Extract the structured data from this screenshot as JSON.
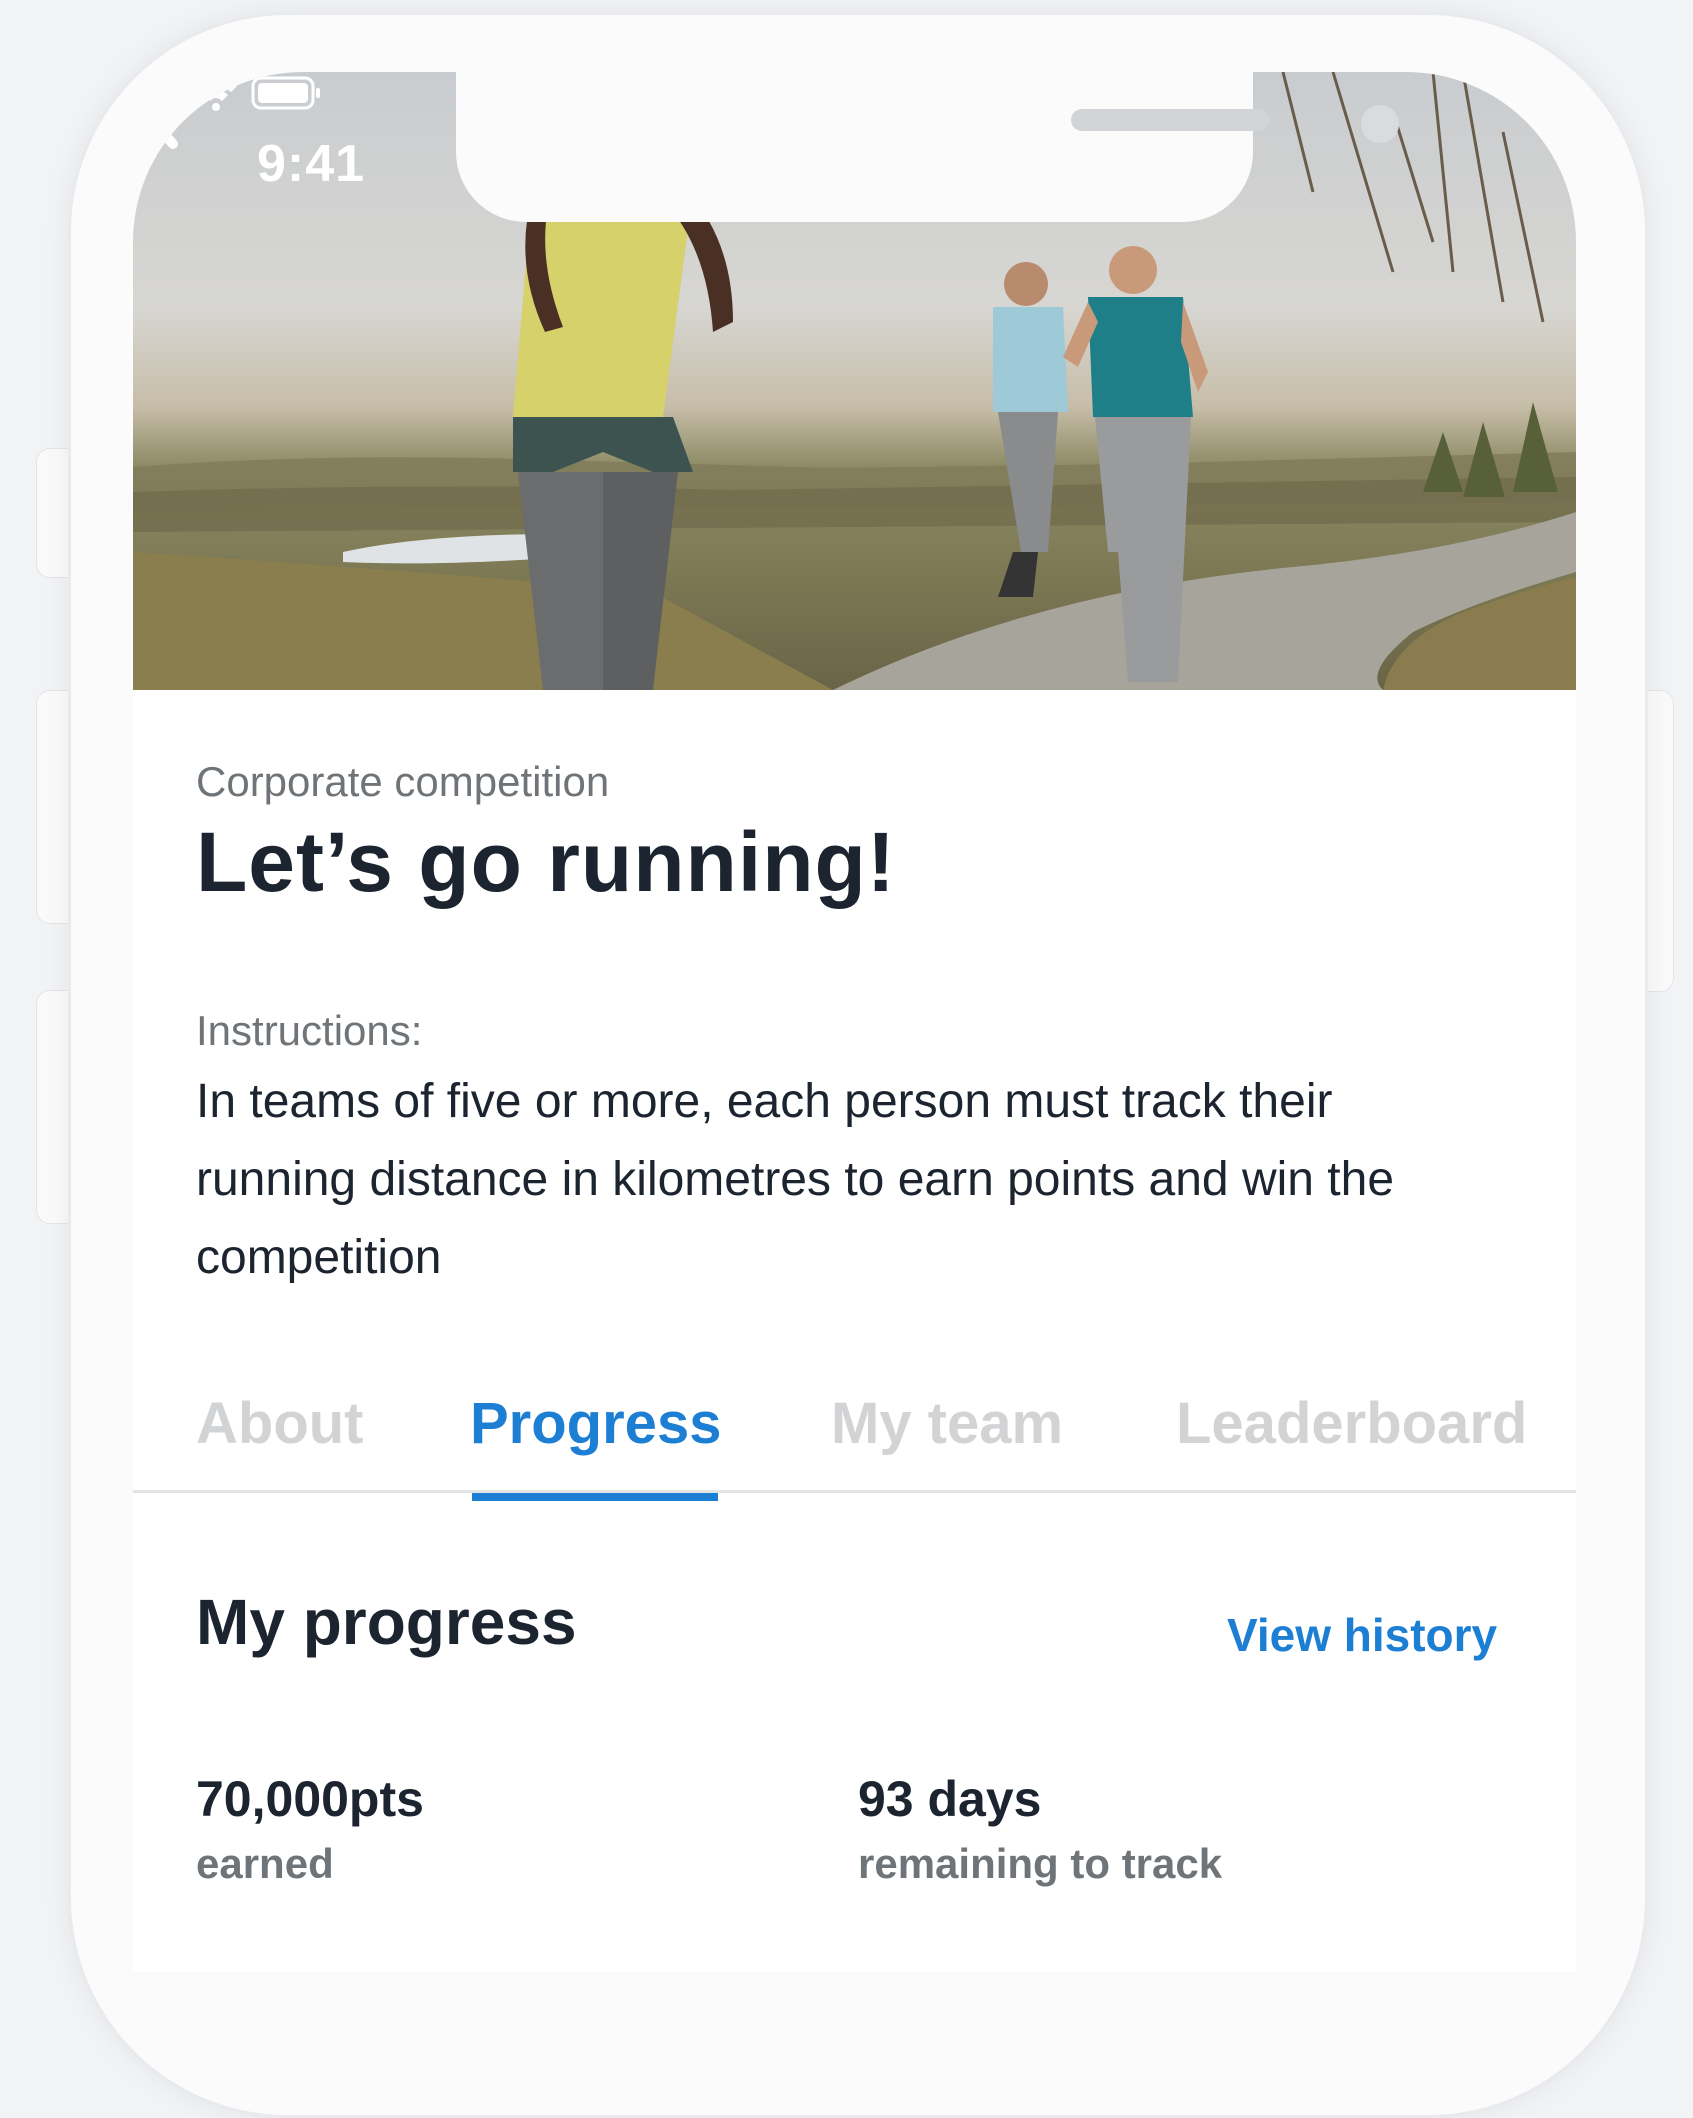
{
  "status_bar": {
    "time": "9:41"
  },
  "header": {
    "back_icon": "chevron-left-icon",
    "more_icon": "more-horizontal-icon"
  },
  "challenge": {
    "category": "Corporate competition",
    "title": "Let’s go running!",
    "instructions_label": "Instructions:",
    "instructions_text": "In teams of five or more, each person must track their running distance in kilometres to earn points and win the competition"
  },
  "tabs": [
    {
      "label": "About",
      "active": false
    },
    {
      "label": "Progress",
      "active": true
    },
    {
      "label": "My team",
      "active": false
    },
    {
      "label": "Leaderboard",
      "active": false
    }
  ],
  "progress": {
    "title": "My progress",
    "view_history_label": "View history",
    "stats": [
      {
        "value": "70,000pts",
        "label": "earned"
      },
      {
        "value": "93 days",
        "label": "remaining to track"
      }
    ]
  },
  "colors": {
    "accent": "#1d7fd4",
    "text_primary": "#1c2430",
    "text_secondary": "#6f7478",
    "tab_inactive": "#d2d3d5"
  }
}
